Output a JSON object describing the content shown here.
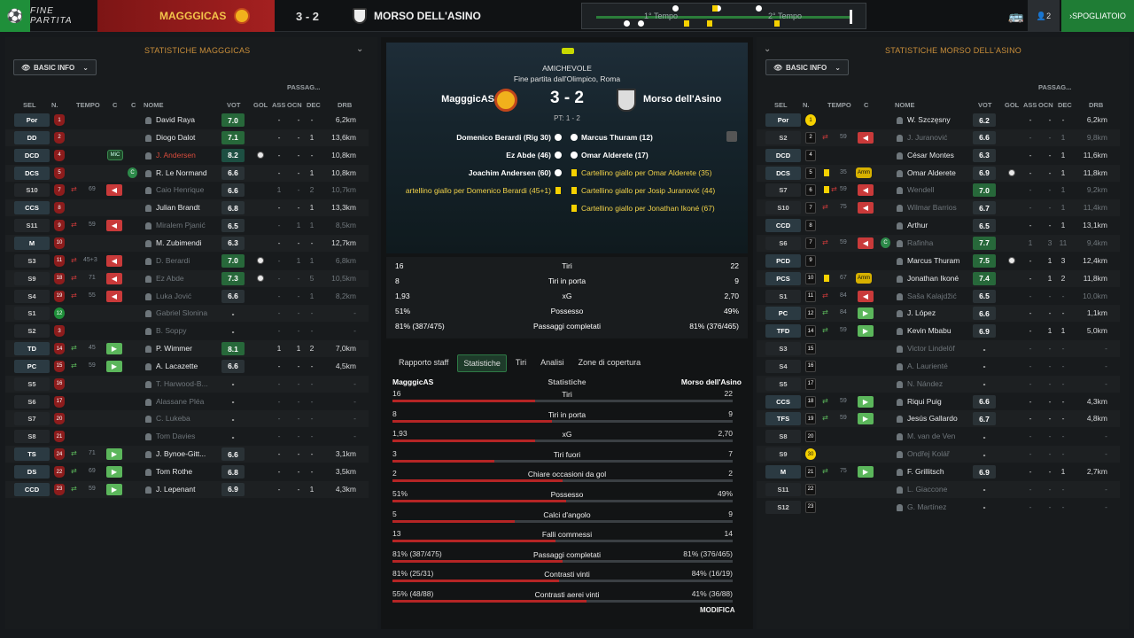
{
  "topbar": {
    "title": "FINE PARTITA",
    "home_team": "MAGGGICAS",
    "score": "3 - 2",
    "away_team": "MORSO DELL'ASINO",
    "timeline_first": "1° Tempo",
    "timeline_second": "2° Tempo",
    "players_count": "2",
    "spogliatoio": "SPOGLIATOIO"
  },
  "left": {
    "title": "STATISTICHE MAGGGICAS",
    "info": "BASIC INFO",
    "headers": {
      "sel": "SEL",
      "n": "N.",
      "tempo": "TEMPO",
      "c": "C",
      "c2": "C",
      "nome": "NOME",
      "vot": "VOT",
      "gol": "GOL",
      "ass": "ASS",
      "passag": "PASSAG...",
      "ocn": "OCN",
      "dec": "DEC",
      "drb": "DRB"
    },
    "rows": [
      {
        "sel": "Por",
        "num": "1",
        "tempo": "",
        "name": "David Raya",
        "vot": "7.0",
        "ass": "-",
        "ocn": "-",
        "dec": "-",
        "drb": "6,2km",
        "dim": false
      },
      {
        "sel": "DD",
        "num": "2",
        "tempo": "",
        "name": "Diogo Dalot",
        "vot": "7.1",
        "ass": "-",
        "ocn": "-",
        "dec": "1",
        "drb": "13,6km",
        "dim": false
      },
      {
        "sel": "DCD",
        "num": "4",
        "tempo": "",
        "badge": "MiC",
        "name": "J. Andersen",
        "vot": "8.2",
        "gol": true,
        "ass": "-",
        "ocn": "-",
        "dec": "-",
        "drb": "10,8km",
        "red": true
      },
      {
        "sel": "DCS",
        "num": "5",
        "tempo": "",
        "c": true,
        "name": "R. Le Normand",
        "vot": "6.6",
        "ass": "-",
        "ocn": "-",
        "dec": "1",
        "drb": "10,8km",
        "dim": false
      },
      {
        "sel": "S10",
        "num": "7",
        "tempo": "69",
        "out": true,
        "name": "Caio Henrique",
        "vot": "6.6",
        "ass": "1",
        "ocn": "-",
        "dec": "2",
        "drb": "10,7km",
        "dim": true
      },
      {
        "sel": "CCS",
        "num": "8",
        "tempo": "",
        "name": "Julian Brandt",
        "vot": "6.8",
        "ass": "-",
        "ocn": "-",
        "dec": "1",
        "drb": "13,3km",
        "dim": false
      },
      {
        "sel": "S11",
        "num": "9",
        "tempo": "59",
        "out": true,
        "name": "Miralem Pjanić",
        "vot": "6.5",
        "ass": "-",
        "ocn": "1",
        "dec": "1",
        "drb": "8,5km",
        "dim": true
      },
      {
        "sel": "M",
        "num": "10",
        "tempo": "",
        "name": "M. Zubimendi",
        "vot": "6.3",
        "ass": "-",
        "ocn": "-",
        "dec": "-",
        "drb": "12,7km",
        "dim": false
      },
      {
        "sel": "S3",
        "num": "11",
        "tempo": "45+3",
        "out": true,
        "name": "D. Berardi",
        "vot": "7.0",
        "gol": true,
        "ass": "-",
        "ocn": "1",
        "dec": "1",
        "drb": "6,8km",
        "dim": true
      },
      {
        "sel": "S9",
        "num": "18",
        "tempo": "71",
        "out": true,
        "name": "Ez Abde",
        "vot": "7.3",
        "gol": true,
        "ass": "-",
        "ocn": "-",
        "dec": "5",
        "drb": "10,5km",
        "dim": true
      },
      {
        "sel": "S4",
        "num": "19",
        "tempo": "55",
        "out": true,
        "name": "Luka Jović",
        "vot": "6.6",
        "ass": "-",
        "ocn": "-",
        "dec": "1",
        "drb": "8,2km",
        "dim": true
      },
      {
        "sel": "S1",
        "num": "12",
        "tempo": "",
        "name": "Gabriel Slonina",
        "vot": "-",
        "ass": "-",
        "ocn": "-",
        "dec": "-",
        "drb": "-",
        "dim": true,
        "green": true
      },
      {
        "sel": "S2",
        "num": "3",
        "tempo": "",
        "name": "B. Soppy",
        "vot": "-",
        "ass": "-",
        "ocn": "-",
        "dec": "-",
        "drb": "-",
        "dim": true
      },
      {
        "sel": "TD",
        "num": "14",
        "tempo": "45",
        "in": true,
        "name": "P. Wimmer",
        "vot": "8.1",
        "ass": "1",
        "ocn": "1",
        "dec": "2",
        "drb": "7,0km",
        "dim": false,
        "red": true
      },
      {
        "sel": "PC",
        "num": "15",
        "tempo": "59",
        "in": true,
        "name": "A. Lacazette",
        "vot": "6.6",
        "ass": "-",
        "ocn": "-",
        "dec": "-",
        "drb": "4,5km",
        "dim": false,
        "red": true
      },
      {
        "sel": "S5",
        "num": "16",
        "tempo": "",
        "name": "T. Harwood-B...",
        "vot": "-",
        "ass": "-",
        "ocn": "-",
        "dec": "-",
        "drb": "-",
        "dim": true
      },
      {
        "sel": "S6",
        "num": "17",
        "tempo": "",
        "name": "Alassane Pléa",
        "vot": "-",
        "ass": "-",
        "ocn": "-",
        "dec": "-",
        "drb": "-",
        "dim": true
      },
      {
        "sel": "S7",
        "num": "20",
        "tempo": "",
        "name": "C. Lukeba",
        "vot": "-",
        "ass": "-",
        "ocn": "-",
        "dec": "-",
        "drb": "-",
        "dim": true
      },
      {
        "sel": "S8",
        "num": "21",
        "tempo": "",
        "name": "Tom Davies",
        "vot": "-",
        "ass": "-",
        "ocn": "-",
        "dec": "-",
        "drb": "-",
        "dim": true
      },
      {
        "sel": "TS",
        "num": "24",
        "tempo": "71",
        "in": true,
        "name": "J. Bynoe-Gitt...",
        "vot": "6.6",
        "ass": "-",
        "ocn": "-",
        "dec": "-",
        "drb": "3,1km",
        "dim": false,
        "red": true
      },
      {
        "sel": "DS",
        "num": "22",
        "tempo": "69",
        "in": true,
        "name": "Tom Rothe",
        "vot": "6.8",
        "ass": "-",
        "ocn": "-",
        "dec": "-",
        "drb": "3,5km",
        "dim": false
      },
      {
        "sel": "CCD",
        "num": "23",
        "tempo": "59",
        "in": true,
        "name": "J. Lepenant",
        "vot": "6.9",
        "ass": "-",
        "ocn": "-",
        "dec": "1",
        "drb": "4,3km",
        "dim": false
      }
    ]
  },
  "right": {
    "title": "STATISTICHE MORSO DELL'ASINO",
    "info": "BASIC INFO",
    "headers": {
      "sel": "SEL",
      "n": "N.",
      "tempo": "TEMPO",
      "c": "C",
      "nome": "NOME",
      "vot": "VOT",
      "gol": "GOL",
      "ass": "ASS",
      "passag": "PASSAG...",
      "ocn": "OCN",
      "dec": "DEC",
      "drb": "DRB"
    },
    "rows": [
      {
        "sel": "Por",
        "num": "1",
        "tempo": "",
        "name": "W. Szczęsny",
        "vot": "6.2",
        "ass": "-",
        "ocn": "-",
        "dec": "-",
        "drb": "6,2km",
        "dim": false,
        "yellow": true
      },
      {
        "sel": "S2",
        "num": "2",
        "tempo": "59",
        "out": true,
        "name": "J. Juranović",
        "vot": "6.6",
        "ass": "-",
        "ocn": "-",
        "dec": "1",
        "drb": "9,8km",
        "dim": true,
        "red": true
      },
      {
        "sel": "DCD",
        "num": "4",
        "tempo": "",
        "name": "César Montes",
        "vot": "6.3",
        "ass": "-",
        "ocn": "-",
        "dec": "1",
        "drb": "11,6km",
        "dim": false
      },
      {
        "sel": "DCS",
        "num": "5",
        "tempo": "35",
        "card": true,
        "amm": true,
        "name": "Omar Alderete",
        "vot": "6.9",
        "gol": true,
        "ass": "-",
        "ocn": "-",
        "dec": "1",
        "drb": "11,8km",
        "dim": false
      },
      {
        "sel": "S7",
        "num": "6",
        "tempo": "59",
        "card": true,
        "out": true,
        "name": "Wendell",
        "vot": "7.0",
        "ass": "-",
        "ocn": "-",
        "dec": "1",
        "drb": "9,2km",
        "dim": true,
        "green": true
      },
      {
        "sel": "S10",
        "num": "7",
        "tempo": "75",
        "out": true,
        "name": "Wilmar Barrios",
        "vot": "6.7",
        "ass": "-",
        "ocn": "-",
        "dec": "1",
        "drb": "11,4km",
        "dim": true
      },
      {
        "sel": "CCD",
        "num": "8",
        "tempo": "",
        "name": "Arthur",
        "vot": "6.5",
        "ass": "-",
        "ocn": "-",
        "dec": "1",
        "drb": "13,1km",
        "dim": false
      },
      {
        "sel": "S6",
        "num": "7",
        "tempo": "59",
        "out": true,
        "c": true,
        "name": "Rafinha",
        "vot": "7.7",
        "ass": "1",
        "ocn": "3",
        "dec": "11",
        "drb": "9,4km",
        "dim": true,
        "green": true
      },
      {
        "sel": "PCD",
        "num": "9",
        "tempo": "",
        "name": "Marcus Thuram",
        "vot": "7.5",
        "gol": true,
        "ass": "-",
        "ocn": "1",
        "dec": "3",
        "drb": "12,4km",
        "dim": false,
        "red": true
      },
      {
        "sel": "PCS",
        "num": "10",
        "tempo": "67",
        "card": true,
        "amm": true,
        "name": "Jonathan Ikoné",
        "vot": "7.4",
        "ass": "-",
        "ocn": "1",
        "dec": "2",
        "drb": "11,8km",
        "dim": false,
        "red": true
      },
      {
        "sel": "S1",
        "num": "11",
        "tempo": "84",
        "out": true,
        "name": "Saša Kalajdžić",
        "vot": "6.5",
        "ass": "-",
        "ocn": "-",
        "dec": "-",
        "drb": "10,0km",
        "dim": true
      },
      {
        "sel": "PC",
        "num": "12",
        "tempo": "84",
        "in": true,
        "name": "J. López",
        "vot": "6.6",
        "ass": "-",
        "ocn": "-",
        "dec": "-",
        "drb": "1,1km",
        "dim": false,
        "red": true
      },
      {
        "sel": "TFD",
        "num": "14",
        "tempo": "59",
        "in": true,
        "name": "Kevin Mbabu",
        "vot": "6.9",
        "ass": "-",
        "ocn": "1",
        "dec": "1",
        "drb": "5,0km",
        "dim": false
      },
      {
        "sel": "S3",
        "num": "15",
        "tempo": "",
        "name": "Victor Lindelöf",
        "vot": "-",
        "ass": "-",
        "ocn": "-",
        "dec": "-",
        "drb": "-",
        "dim": true
      },
      {
        "sel": "S4",
        "num": "16",
        "tempo": "",
        "name": "A. Laurienté",
        "vot": "-",
        "ass": "-",
        "ocn": "-",
        "dec": "-",
        "drb": "-",
        "dim": true
      },
      {
        "sel": "S5",
        "num": "17",
        "tempo": "",
        "name": "N. Nández",
        "vot": "-",
        "ass": "-",
        "ocn": "-",
        "dec": "-",
        "drb": "-",
        "dim": true
      },
      {
        "sel": "CCS",
        "num": "18",
        "tempo": "59",
        "in": true,
        "name": "Riqui Puig",
        "vot": "6.6",
        "ass": "-",
        "ocn": "-",
        "dec": "-",
        "drb": "4,3km",
        "dim": false
      },
      {
        "sel": "TFS",
        "num": "19",
        "tempo": "59",
        "in": true,
        "name": "Jesús Gallardo",
        "vot": "6.7",
        "ass": "-",
        "ocn": "-",
        "dec": "-",
        "drb": "4,8km",
        "dim": false
      },
      {
        "sel": "S8",
        "num": "20",
        "tempo": "",
        "name": "M. van de Ven",
        "vot": "-",
        "ass": "-",
        "ocn": "-",
        "dec": "-",
        "drb": "-",
        "dim": true
      },
      {
        "sel": "S9",
        "num": "30",
        "tempo": "",
        "name": "Ondřej Kolář",
        "vot": "-",
        "ass": "-",
        "ocn": "-",
        "dec": "-",
        "drb": "-",
        "dim": true,
        "yellow": true
      },
      {
        "sel": "M",
        "num": "21",
        "tempo": "75",
        "in": true,
        "name": "F. Grillitsch",
        "vot": "6.9",
        "ass": "-",
        "ocn": "-",
        "dec": "1",
        "drb": "2,7km",
        "dim": false
      },
      {
        "sel": "S11",
        "num": "22",
        "tempo": "",
        "name": "L. Giaccone",
        "vot": "-",
        "ass": "-",
        "ocn": "-",
        "dec": "-",
        "drb": "-",
        "dim": true
      },
      {
        "sel": "S12",
        "num": "23",
        "tempo": "",
        "name": "G. Martínez",
        "vot": "-",
        "ass": "-",
        "ocn": "-",
        "dec": "-",
        "drb": "-",
        "dim": true
      }
    ]
  },
  "center": {
    "competition": "AMICHEVOLE",
    "venue": "Fine partita dall'Olimpico, Roma",
    "home": "MagggicAS",
    "away": "Morso dell'Asino",
    "score": "3 - 2",
    "pt": "PT: 1 - 2",
    "events_left": [
      {
        "text": "Domenico Berardi (Rig 30)",
        "type": "goal"
      },
      {
        "text": "Ez Abde (46)",
        "type": "goal"
      },
      {
        "text": "Joachim Andersen (60)",
        "type": "goal"
      },
      {
        "text": "artellino giallo per Domenico Berardi (45+1)",
        "type": "card"
      }
    ],
    "events_right": [
      {
        "text": "Marcus Thuram (12)",
        "type": "goal"
      },
      {
        "text": "Omar Alderete (17)",
        "type": "goal"
      },
      {
        "text": "Cartellino giallo per Omar Alderete (35)",
        "type": "card"
      },
      {
        "text": "Cartellino giallo per Josip Juranović (44)",
        "type": "card"
      },
      {
        "text": "Cartellino giallo per Jonathan Ikoné (67)",
        "type": "card"
      }
    ],
    "summary": [
      {
        "l": "16",
        "c": "Tiri",
        "r": "22"
      },
      {
        "l": "8",
        "c": "Tiri in porta",
        "r": "9"
      },
      {
        "l": "1,93",
        "c": "xG",
        "r": "2,70"
      },
      {
        "l": "51%",
        "c": "Possesso",
        "r": "49%"
      },
      {
        "l": "81% (387/475)",
        "c": "Passaggi completati",
        "r": "81% (376/465)"
      }
    ],
    "tabs": [
      "Rapporto staff",
      "Statistiche",
      "Tiri",
      "Analisi",
      "Zone di copertura"
    ],
    "stats_header": {
      "home": "MagggicAS",
      "mid": "Statistiche",
      "away": "Morso dell'Asino"
    },
    "stats": [
      {
        "l": "16",
        "c": "Tiri",
        "r": "22",
        "frac": 0.42
      },
      {
        "l": "8",
        "c": "Tiri in porta",
        "r": "9",
        "frac": 0.47
      },
      {
        "l": "1,93",
        "c": "xG",
        "r": "2,70",
        "frac": 0.42
      },
      {
        "l": "3",
        "c": "Tiri fuori",
        "r": "7",
        "frac": 0.3
      },
      {
        "l": "2",
        "c": "Chiare occasioni da gol",
        "r": "2",
        "frac": 0.5
      },
      {
        "l": "51%",
        "c": "Possesso",
        "r": "49%",
        "frac": 0.51
      },
      {
        "l": "5",
        "c": "Calci d'angolo",
        "r": "9",
        "frac": 0.36
      },
      {
        "l": "13",
        "c": "Falli commessi",
        "r": "14",
        "frac": 0.48
      },
      {
        "l": "81% (387/475)",
        "c": "Passaggi completati",
        "r": "81% (376/465)",
        "frac": 0.5
      },
      {
        "l": "81% (25/31)",
        "c": "Contrasti vinti",
        "r": "84% (16/19)",
        "frac": 0.49
      },
      {
        "l": "55% (48/88)",
        "c": "Contrasti aerei vinti",
        "r": "41% (36/88)",
        "frac": 0.57
      }
    ],
    "modifica": "MODIFICA"
  }
}
